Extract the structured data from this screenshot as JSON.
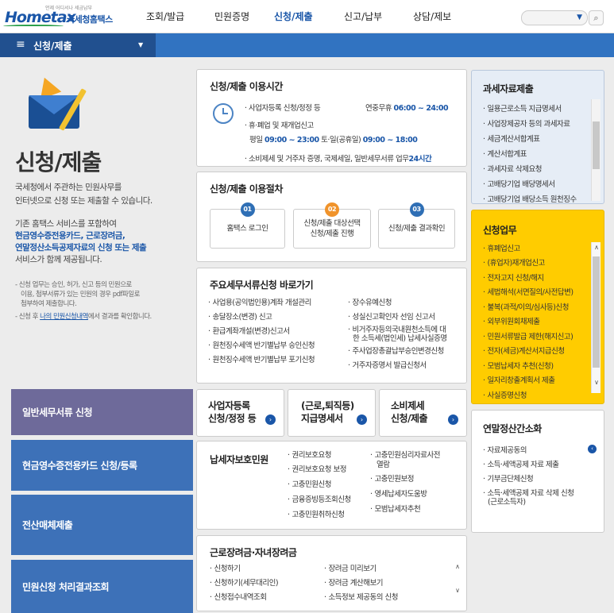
{
  "header": {
    "logo_tagline": "언제 어디서나 세금납부",
    "logo_word": "Hometax",
    "logo_kor": "국세청홈택스",
    "nav": [
      "조회/발급",
      "민원증명",
      "신청/제출",
      "신고/납부",
      "상담/제보"
    ],
    "search_placeholder": ""
  },
  "menu": {
    "label": "신청/제출"
  },
  "hero": {
    "title": "신청/제출",
    "desc1": "국세청에서 주관하는 민원사무를",
    "desc2": "인터넷으로 신청 또는 제출할 수 있습니다.",
    "p1": "기존 홈택스 서비스를 포함하여",
    "p2": "현금영수증전용카드, 근로장려금,",
    "p3a": "연말정산소득공제자료의 신청 또는 제출",
    "p3b": "",
    "p4": "서비스가 함께 제공됩니다.",
    "note1": "신청 업무는 승인, 허가, 신고 등의 민원으로",
    "note1b": "이용, 첨부서류가 있는 민원의 경우 pdf파일로",
    "note1c": "첨부하여 제출합니다.",
    "note2a": "신청 후 ",
    "note2link": "나의 민원신청내역",
    "note2b": "에서 결과를 확인합니다."
  },
  "left_buttons": [
    {
      "label": "일반세무서류 신청",
      "color": "#6e6a9a"
    },
    {
      "label": "현금영수증전용카드 신청/등록",
      "color": "#3d71b8"
    },
    {
      "label": "전산매체제출",
      "color": "#3d71b8"
    },
    {
      "label": "민원신청 처리결과조회",
      "color": "#3d71b8"
    }
  ],
  "hours": {
    "title": "신청/제출 이용시간",
    "r1": "사업자등록 신청/정정 등",
    "r1t_label": "연중무휴",
    "r1t": "06:00 ~ 24:00",
    "r2": "휴·폐업 및 재개업신고",
    "r3a": "평일",
    "r3b": "09:00 ~ 23:00",
    "r3c": "토·일(공휴일)",
    "r3d": "09:00 ~ 18:00",
    "r4": "소비제세 및 거주자 증명, 국제세일, 일반세무서류 업무",
    "r4b": "24시간"
  },
  "procedure": {
    "title": "신청/제출 이용절차",
    "steps": [
      {
        "num": "01",
        "l1": "홈택스 로그인",
        "l2": "",
        "color": "#2f6fb5"
      },
      {
        "num": "02",
        "l1": "신청/제출 대상선택",
        "l2": "신청/제출 진행",
        "color": "#f0932b"
      },
      {
        "num": "03",
        "l1": "신청/제출 결과확인",
        "l2": "",
        "color": "#2f6fb5"
      }
    ]
  },
  "shortcuts": {
    "title": "주요세무서류신청 바로가기",
    "left": [
      "사업용(공익법인용)계좌 개설관리",
      "송달장소(변경) 신고",
      "환급계좌개설(변경)신고서",
      "원천징수세액 반기별납부 승인신청",
      "원천징수세액 반기별납부 포기신청"
    ],
    "right": [
      "장수유예신청",
      "성실신고확인자 선임 신고서",
      "비거주자등의국내원천소득에 대",
      "한 소득세(법인세) 납세사실증명",
      "주사업장총괄납부승인변경신청",
      "거주자증명서 발급신청서"
    ]
  },
  "big_buttons": [
    {
      "l1": "사업자등록",
      "l2": "신청/정정 등"
    },
    {
      "l1": "(근로,퇴직등)",
      "l2": "지급명세서"
    },
    {
      "l1": "소비제세",
      "l2": "신청/제출"
    }
  ],
  "protection": {
    "title": "납세자보호민원",
    "col1": [
      "권리보호요청",
      "권리보호요청 보정",
      "고충민원신청",
      "금융증빙등조회신청",
      "고충민원취하신청"
    ],
    "col2": [
      "고충민원심리자료사전",
      "열람",
      "고충민원보정",
      "영세납세자도움방",
      "모범납세자추천"
    ]
  },
  "incentive": {
    "title": "근로장려금·자녀장려금",
    "col1": [
      "신청하기",
      "신청하기(세무대리인)",
      "신청접수내역조회"
    ],
    "col2": [
      "장려금 미리보기",
      "장려금 계산해보기",
      "소득정보 제공동의 신청"
    ]
  },
  "tax_data": {
    "title": "과세자료제출",
    "items": [
      "일용근로소득 지급명세서",
      "사업장제공자 등의 과세자료",
      "세금계산서합계표",
      "계산서합계표",
      "과세자료 삭제요청",
      "고배당기업 배당명세서",
      "고배당기업 배당소득 원천징수"
    ]
  },
  "apply": {
    "title": "신청업무",
    "items": [
      "휴폐업신고",
      "(휴업자)재개업신고",
      "전자고지 신청/해지",
      "세법해석(서면질의/사전답변)",
      "불복(과적/이의/심사등)신청",
      "외부위원회채제출",
      "민원서류발급 제한(해지신고)",
      "전자(세금)계산서지급신청",
      "모범납세자 추천(신청)",
      "일자리창출계획서 제출",
      "사실증명신청"
    ]
  },
  "yearend": {
    "title": "연말정산간소화",
    "items": [
      "자료제공동의",
      "소득·세액공제 자료 제출",
      "기부금단체신청",
      "소득·세액공제 자료 삭제 신청",
      "(근로소득자)"
    ]
  }
}
